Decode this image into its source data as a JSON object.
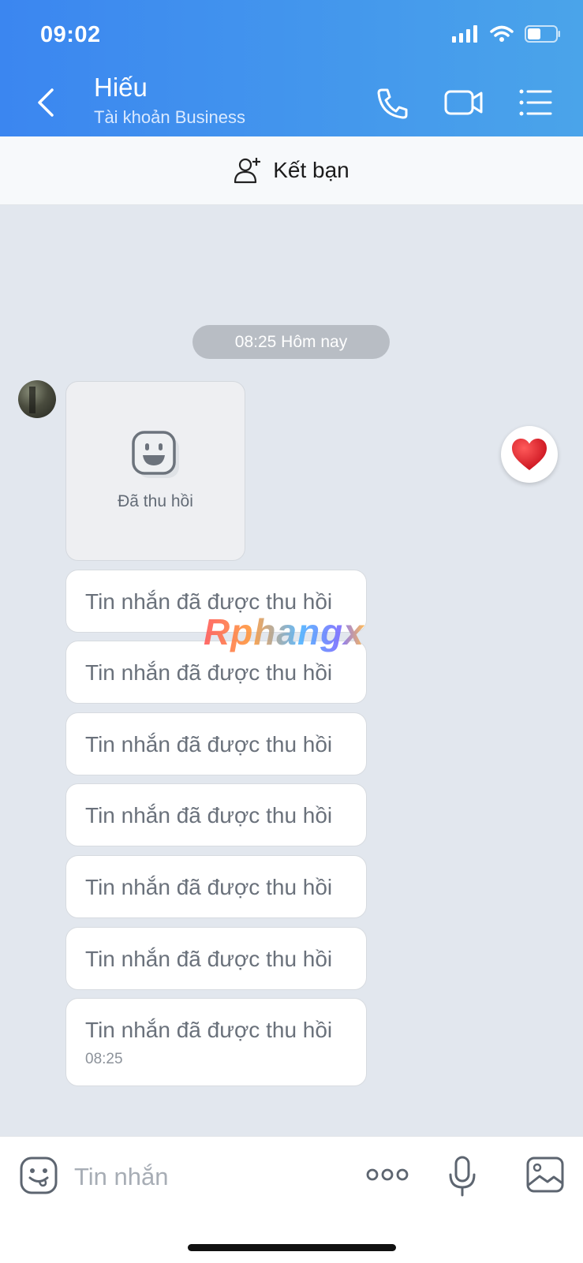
{
  "status_bar": {
    "time": "09:02"
  },
  "header": {
    "contact_name": "Hiếu",
    "account_type": "Tài khoản Business"
  },
  "add_friend": {
    "label": "Kết bạn"
  },
  "chat": {
    "date_pill": "08:25 Hôm nay",
    "revoked_media_label": "Đã thu hồi",
    "messages": [
      {
        "text": "Tin nhắn đã được thu hồi"
      },
      {
        "text": "Tin nhắn đã được thu hồi"
      },
      {
        "text": "Tin nhắn đã được thu hồi"
      },
      {
        "text": "Tin nhắn đã được thu hồi"
      },
      {
        "text": "Tin nhắn đã được thu hồi"
      },
      {
        "text": "Tin nhắn đã được thu hồi"
      },
      {
        "text": "Tin nhắn đã được thu hồi",
        "time": "08:25"
      }
    ],
    "reaction": "heart-icon"
  },
  "watermark": "Rphangx",
  "composer": {
    "placeholder": "Tin nhắn"
  },
  "colors": {
    "header_start": "#3b86f0",
    "header_end": "#4aa4ea",
    "chat_bg": "#e2e7ee",
    "heart": "#e0202e"
  }
}
